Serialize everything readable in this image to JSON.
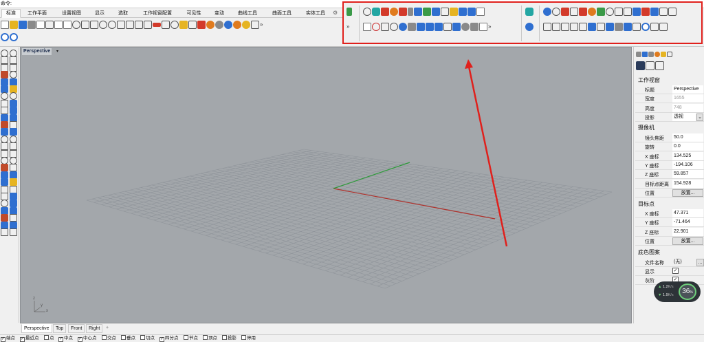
{
  "command_line": {
    "text": "命令:"
  },
  "menu_tabs": [
    "标准",
    "工作平面",
    "设置视图",
    "显示",
    "选取",
    "工作视窗配置",
    "可见性",
    "变动",
    "曲线工具",
    "曲面工具",
    "实体工具"
  ],
  "toolbar": {
    "more_label": "»"
  },
  "viewport": {
    "title": "Perspective",
    "dropdown": "▾",
    "grid_color": "#8f949a",
    "x_axis_color": "#b0302a",
    "y_axis_color": "#2e9a3a",
    "axis_labels": {
      "z": "z",
      "y": "y",
      "x": "x"
    }
  },
  "viewport_tabs": [
    "Perspective",
    "Top",
    "Front",
    "Right"
  ],
  "viewport_tab_add": "+",
  "properties": {
    "sections": {
      "viewport": "工作视窗",
      "camera": "摄像机",
      "target": "目标点",
      "wallpaper": "底色图案"
    },
    "viewport_rows": [
      {
        "key": "标题",
        "value": "Perspective",
        "disabled": false
      },
      {
        "key": "宽度",
        "value": "1655",
        "disabled": true
      },
      {
        "key": "高度",
        "value": "748",
        "disabled": true
      },
      {
        "key": "投影",
        "value": "透视",
        "disabled": false
      }
    ],
    "camera_rows": [
      {
        "key": "镜头焦距",
        "value": "50.0"
      },
      {
        "key": "旋转",
        "value": "0.0"
      },
      {
        "key": "X 座标",
        "value": "134.525"
      },
      {
        "key": "Y 座标",
        "value": "-194.106"
      },
      {
        "key": "Z 座标",
        "value": "59.857"
      },
      {
        "key": "目标点距离",
        "value": "154.928"
      }
    ],
    "position_label": "位置",
    "place_button": "放置...",
    "target_rows": [
      {
        "key": "X 座标",
        "value": "47.371"
      },
      {
        "key": "Y 座标",
        "value": "-71.464"
      },
      {
        "key": "Z 座标",
        "value": "22.901"
      }
    ],
    "wallpaper_rows": {
      "filename_label": "文件名称",
      "filename_value": "(无)",
      "browse": "...",
      "show_label": "显示",
      "gray_label": "灰阶"
    }
  },
  "snaps": [
    {
      "label": "端点",
      "checked": true
    },
    {
      "label": "最近点",
      "checked": true
    },
    {
      "label": "点",
      "checked": false
    },
    {
      "label": "中点",
      "checked": true
    },
    {
      "label": "中心点",
      "checked": true
    },
    {
      "label": "交点",
      "checked": false
    },
    {
      "label": "垂点",
      "checked": false
    },
    {
      "label": "切点",
      "checked": false
    },
    {
      "label": "四分点",
      "checked": true
    },
    {
      "label": "节点",
      "checked": false
    },
    {
      "label": "顶点",
      "checked": false
    },
    {
      "label": "投影",
      "checked": false
    },
    {
      "label": "停用",
      "checked": false
    }
  ],
  "net_widget": {
    "up": "1.2",
    "down": "1.9",
    "up_unit": "K/s",
    "down_unit": "K/s",
    "percent": "36",
    "percent_unit": "%"
  },
  "colors": {
    "highlight": "#e0201c",
    "arrow": "#e0201c",
    "viewport_bg": "#a3a7ab"
  }
}
